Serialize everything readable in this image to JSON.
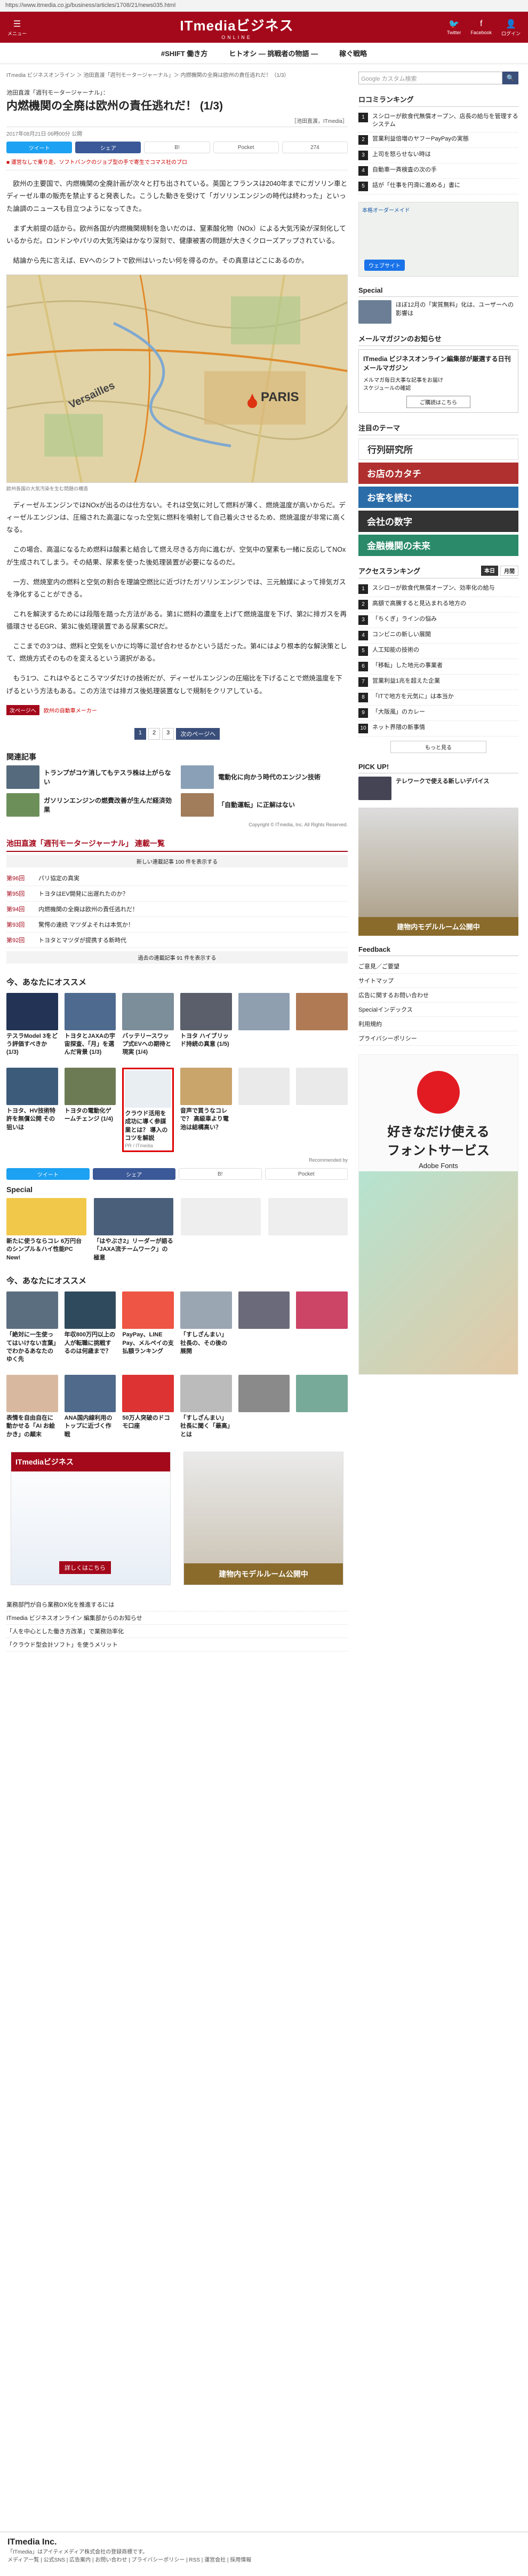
{
  "browser": {
    "url": "https://www.itmedia.co.jp/business/articles/1708/21/news035.html"
  },
  "topbar": {
    "menu": "メニュー",
    "logo": "ITmediaビジネス",
    "logo_sub": "ONLINE",
    "twitter": "Twitter",
    "facebook": "Facebook",
    "login": "ログイン"
  },
  "nav": [
    "#SHIFT 働き方",
    "ヒトオシ ― 挑戦者の物語 ―",
    "稼ぐ戦略"
  ],
  "article": {
    "breadcrumb": "ITmedia ビジネスオンライン ＞ 池田直渡「週刊モータージャーナル」＞ 内燃機関の全廃は欧州の責任逃れだ！（1/3）",
    "kicker": "池田直渡「週刊モータージャーナル」：",
    "title": "内燃機関の全廃は欧州の責任逃れだ！ (1/3)",
    "byline": "［池田直渡，ITmedia］",
    "date": "2017年08月21日 06時00分 公開",
    "share": {
      "twitter": "ツイート",
      "facebook": "シェア",
      "hatena": "B!",
      "pocket": "Pocket",
      "count": "274"
    },
    "alert": "■ 運営なしで乗り走、ソフトバンクのジョブ型の手で寄生でコマス社のプロ",
    "paragraphs": [
      "欧州の主要国で、内燃機関の全廃計画が次々と打ち出されている。英国とフランスは2040年までにガソリン車とディーゼル車の販売を禁止すると発表した。こうした動きを受けて「ガソリンエンジンの時代は終わった」といった論調のニュースも目立つようになってきた。",
      "まず大前提の話から。欧州各国が内燃機関規制を急いだのは、窒素酸化物（NOx）による大気汚染が深刻化しているからだ。ロンドンやパリの大気汚染はかなり深刻で、健康被害の問題が大きくクローズアップされている。",
      "結論から先に言えば、EVへのシフトで欧州はいったい何を得るのか。その真意はどこにあるのか。"
    ],
    "map_caption": "欧州各国の大気汚染を生む問題の構造",
    "map_labels": {
      "city": "PARIS",
      "city2": "Versailles"
    },
    "paragraphs2": [
      "ディーゼルエンジンではNOxが出るのは仕方ない。それは空気に対して燃料が薄く、燃焼温度が高いからだ。ディーゼルエンジンは、圧縮された高温になった空気に燃料を噴射して自己着火させるため、燃焼温度が非常に高くなる。",
      "この場合、高温になるため燃料は酸素と結合して燃え尽きる方向に進むが、空気中の窒素も一緒に反応してNOxが生成されてしまう。その結果、尿素を使った後処理装置が必要になるのだ。",
      "一方、燃焼室内の燃料と空気の割合を理論空燃比に近づけたガソリンエンジンでは、三元触媒によって排気ガスを浄化することができる。",
      "これを解決するためには段階を踏った方法がある。第1に燃料の濃度を上げて燃焼温度を下げ、第2に排ガスを再循環させるEGR、第3に後処理装置である尿素SCRだ。",
      "ここまでの3つは、燃料と空気をいかに均等に混ぜ合わせるかという話だった。第4にはより根本的な解決策として、燃焼方式そのものを変えるという選択がある。",
      "もう1つ、これはやるところマツダだけの技術だが、ディーゼルエンジンの圧縮比を下げることで燃焼温度を下げるという方法もある。この方法では排ガス後処理装置なしで規制をクリアしている。"
    ],
    "prev_btn": "次ページへ",
    "prev_text": "欧州の自動車メーカー",
    "pager": [
      "1",
      "2",
      "3",
      "次のページへ"
    ]
  },
  "related": {
    "heading": "関連記事",
    "items": [
      "トランプがコケ消してもテスラ株は上がらない",
      "電動化に向かう時代のエンジン技術",
      "ガソリンエンジンの燃費改善が生んだ経済効果",
      "「自動運転」に正解はない"
    ]
  },
  "copyright": "Copyright © ITmedia, Inc. All Rights Reserved.",
  "series": {
    "heading": "池田直渡「週刊モータージャーナル」 連載一覧",
    "sub": "新しい連載記事 100 件を表示する",
    "rows": [
      {
        "no": "第96回",
        "title": "パリ協定の真実"
      },
      {
        "no": "第95回",
        "title": "トヨタはEV開発に出遅れたのか？"
      },
      {
        "no": "第94回",
        "title": "内燃機関の全廃は欧州の責任逃れだ！"
      },
      {
        "no": "第93回",
        "title": "驚愕の連続 マツダよそれは本気か！"
      },
      {
        "no": "第92回",
        "title": "トヨタとマツダが提携する新時代"
      }
    ],
    "foot": "過去の連載記事 91 件を表示する"
  },
  "recommend": {
    "heading": "今、あなたにオススメ",
    "items": [
      "テスラModel 3をどう評価すべきか (1/3)",
      "トヨタとJAXAの宇宙探査、「月」を選んだ背景 (1/3)",
      "バッテリースワップ式EVへの期待と現実 (1/4)",
      "トヨタ ハイブリッド持続の真意 (1/5)",
      "",
      "",
      "トヨタ、HV技術特許を無償公開 その狙いは",
      "トヨタの電動化ゲームチェンジ (1/4)",
      "クラウド活用を成功に導く参謀業とは？ 導入のコツを解説",
      "音声で買うなコレで？ 高級車より電池は結構高い？",
      "",
      ""
    ],
    "sponsor": "PR / ITmedia",
    "foot": "Recommended by"
  },
  "special": {
    "heading": "Special",
    "items": [
      "新たに使うならコレ 6万円台のシンプル＆ハイ性能PC New!",
      "「はやぶさ2」リーダーが語る「JAXA流チームワーク」の極意",
      "",
      ""
    ]
  },
  "recommend2": {
    "heading": "今、あなたにオススメ",
    "items": [
      "「絶対に一生使ってはいけない言葉」でわかるあなたのゆく先",
      "年収800万円以上の人が転職に挑戦するのは何歳まで？",
      "PayPay、LINE Pay、メルペイの支払額ランキング",
      "「すしざんまい」社長の、その後の展開",
      "",
      "",
      "表情を自由自在に動かせる「AI お絵かき」の顛末",
      "ANA国内線利用のトップに近づく作戦",
      "50万人突破のドコモ口座",
      "「すしざんまい」社長に聞く「最高」とは",
      "",
      ""
    ]
  },
  "ad": {
    "cta": "詳しくはこちら",
    "ad2": "建物内モデルルーム公開中"
  },
  "bottom_links": [
    "業務部門が自ら業務DX化を推進するには",
    "ITmedia ビジネスオンライン 編集部からのお知らせ",
    "「人を中心とした働き方改革」で業務効率化",
    "「クラウド型会計ソフト」を使うメリット"
  ],
  "footer": {
    "brand": "ITmedia Inc.",
    "text": "「ITmedia」はアイティメディア株式会社の登録商標です。",
    "links": "メディア一覧 | 公式SNS | 広告案内 | お問い合わせ | プライバシーポリシー | RSS | 運営会社 | 採用情報"
  },
  "sidebar": {
    "search_placeholder": "Google カスタム検索",
    "ranking_h": "ロコミランキング",
    "ranking": [
      "スシローが飲食代無償オープン、店長の給与を管理するシステム",
      "営業利益倍増のヤフーPayPayの実態",
      "上司を怒らせない時は",
      "自動車一斉検査の次の手",
      "話が「仕事を円滑に進める」書に"
    ],
    "ad_text": "本格オーダーメイド",
    "ad_btn": "ウェブサイト",
    "special_h": "Special",
    "special_item": "ほぼ12月の「実質無料」化は、ユーザーへの影響は",
    "mail_h": "メールマガジンのお知らせ",
    "mail_title": "ITmedia ビジネスオンライン編集部が厳選する日刊メールマガジン",
    "mail_items": [
      "メルマガ毎日大事な記事をお届け",
      "スケジュールの確認"
    ],
    "mail_btn": "ご購読はこちら",
    "theme_h": "注目のテーマ",
    "themes": [
      "行列研究所",
      "お店のカタチ",
      "お客を読む",
      "会社の数字",
      "金融機関の未来"
    ],
    "access_h": "アクセスランキング",
    "access_tabs": [
      "本日",
      "月間"
    ],
    "access": [
      "スシローが飲食代無償オープン、効率化の給与",
      "高額で高騰すると見込まれる地方の",
      "「ちくぎ」ラインの悩み",
      "コンビニの新しい展開",
      "人工知能の技術の",
      "「移転」した地元の事業者",
      "営業利益1兆を超えた企業",
      "「ITで地方を元気に」は本当か",
      "「大阪風」のカレー",
      "ネット界隈の新事情"
    ],
    "more_btn": "もっと見る",
    "pickup_h": "PICK UP!",
    "pickup_item": "テレワークで使える新しいデバイス",
    "feedback_h": "Feedback",
    "feedback": [
      "ご意見／ご要望",
      "サイトマップ",
      "広告に関するお問い合わせ",
      "Specialインデックス",
      "利用規約",
      "プライバシーポリシー"
    ],
    "ad3_title": "好きなだけ使える",
    "ad3_sub": "フォントサービス",
    "ad3_brand": "Adobe Fonts"
  },
  "colors": {
    "brand": "#a4091b",
    "nav_blue": "#3a4e7a"
  }
}
